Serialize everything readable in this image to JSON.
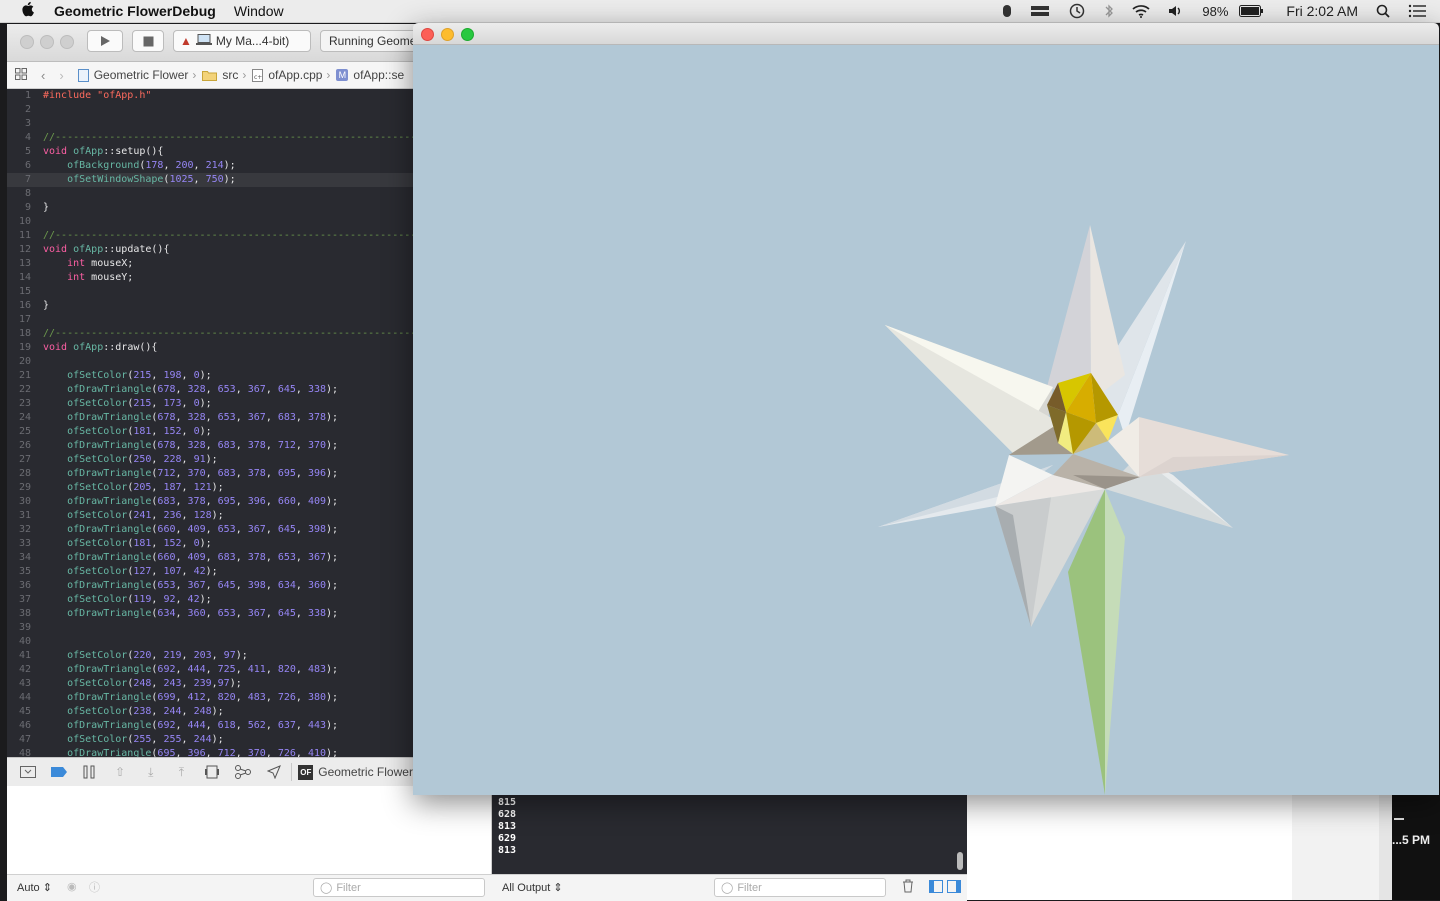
{
  "menubar": {
    "app_name": "Geometric FlowerDebug",
    "menus": [
      "Window"
    ],
    "battery": "98%",
    "clock": "Fri 2:02 AM"
  },
  "toolbar": {
    "scheme": "My Ma...4-bit)",
    "status": "Running Geome"
  },
  "jumpbar": {
    "items": [
      "Geometric Flower",
      "src",
      "ofApp.cpp",
      "ofApp::se"
    ]
  },
  "code_lines": [
    "#include \"ofApp.h\"",
    "",
    "",
    "//------------------------------------------------------------------",
    "void ofApp::setup(){",
    "    ofBackground(178, 200, 214);",
    "    ofSetWindowShape(1025, 750);",
    "",
    "}",
    "",
    "//------------------------------------------------------------------",
    "void ofApp::update(){",
    "    int mouseX;",
    "    int mouseY;",
    "",
    "}",
    "",
    "//------------------------------------------------------------------",
    "void ofApp::draw(){",
    "",
    "    ofSetColor(215, 198, 0);",
    "    ofDrawTriangle(678, 328, 653, 367, 645, 338);",
    "    ofSetColor(215, 173, 0);",
    "    ofDrawTriangle(678, 328, 653, 367, 683, 378);",
    "    ofSetColor(181, 152, 0);",
    "    ofDrawTriangle(678, 328, 683, 378, 712, 370);",
    "    ofSetColor(250, 228, 91);",
    "    ofDrawTriangle(712, 370, 683, 378, 695, 396);",
    "    ofSetColor(205, 187, 121);",
    "    ofDrawTriangle(683, 378, 695, 396, 660, 409);",
    "    ofSetColor(241, 236, 128);",
    "    ofDrawTriangle(660, 409, 653, 367, 645, 398);",
    "    ofSetColor(181, 152, 0);",
    "    ofDrawTriangle(660, 409, 683, 378, 653, 367);",
    "    ofSetColor(127, 107, 42);",
    "    ofDrawTriangle(653, 367, 645, 398, 634, 360);",
    "    ofSetColor(119, 92, 42);",
    "    ofDrawTriangle(634, 360, 653, 367, 645, 338);",
    "",
    "",
    "    ofSetColor(220, 219, 203, 97);",
    "    ofDrawTriangle(692, 444, 725, 411, 820, 483);",
    "    ofSetColor(248, 243, 239,97);",
    "    ofDrawTriangle(699, 412, 820, 483, 726, 380);",
    "    ofSetColor(238, 244, 248);",
    "    ofDrawTriangle(692, 444, 618, 562, 637, 443);",
    "    ofSetColor(255, 255, 244);",
    "    ofDrawTriangle(695, 396, 712, 370, 726, 410);"
  ],
  "highlighted_line": 7,
  "debugbar": {
    "target": "Geometric Flower"
  },
  "console_lines": [
    "815",
    "628",
    "813",
    "629",
    "813"
  ],
  "bottombar": {
    "auto_label": "Auto",
    "filter_placeholder": "Filter",
    "output_label": "All Output"
  },
  "sidebar_time": "...5 PM",
  "canvas": {
    "background": "#b2c8d6"
  }
}
